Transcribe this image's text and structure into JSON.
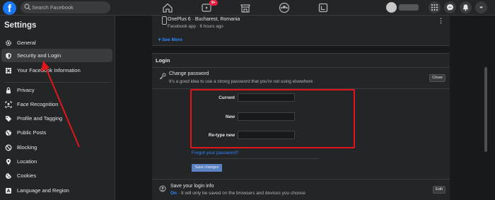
{
  "topbar": {
    "logo": "f",
    "search_placeholder": "Search Facebook",
    "video_badge": "9+",
    "nav_icons": [
      "home-icon",
      "watch-icon",
      "marketplace-icon",
      "groups-icon",
      "gaming-icon"
    ],
    "right_icons": [
      "menu-grid-icon",
      "messenger-icon",
      "notifications-icon",
      "account-chevron-icon"
    ]
  },
  "sidebar": {
    "title": "Settings",
    "items": [
      {
        "label": "General",
        "icon": "gear-icon"
      },
      {
        "label": "Security and Login",
        "icon": "shield-icon",
        "active": true
      },
      {
        "label": "Your Facebook Information",
        "icon": "facebook-grid-icon"
      },
      {
        "label": "Privacy",
        "icon": "lock-icon"
      },
      {
        "label": "Face Recognition",
        "icon": "face-icon"
      },
      {
        "label": "Profile and Tagging",
        "icon": "tag-icon"
      },
      {
        "label": "Public Posts",
        "icon": "globe-icon"
      },
      {
        "label": "Blocking",
        "icon": "block-icon"
      },
      {
        "label": "Location",
        "icon": "location-pin-icon"
      },
      {
        "label": "Cookies",
        "icon": "cookie-icon"
      },
      {
        "label": "Language and Region",
        "icon": "language-icon"
      }
    ]
  },
  "session": {
    "device": "OnePlus 6 · Bucharest, Romania",
    "detail": "Facebook app · 6 hours ago",
    "see_more": "See More"
  },
  "login": {
    "heading": "Login",
    "change_password": {
      "title": "Change password",
      "subtitle": "It's a good idea to use a strong password that you're not using elsewhere",
      "close_label": "Close"
    },
    "fields": [
      {
        "label": "Current",
        "value": ""
      },
      {
        "label": "New",
        "value": ""
      },
      {
        "label": "Re-type new",
        "value": ""
      }
    ],
    "forgot_label": "Forgot your password?",
    "save_label": "Save changes",
    "save_info": {
      "title": "Save your login info",
      "on_label": "On",
      "subtitle": "· It will only be saved on the browsers and devices you choose",
      "edit_label": "Edit"
    }
  },
  "colors": {
    "accent": "#2d88ff",
    "annotation": "#e0161b",
    "background": "#18191a",
    "surface": "#242526"
  }
}
